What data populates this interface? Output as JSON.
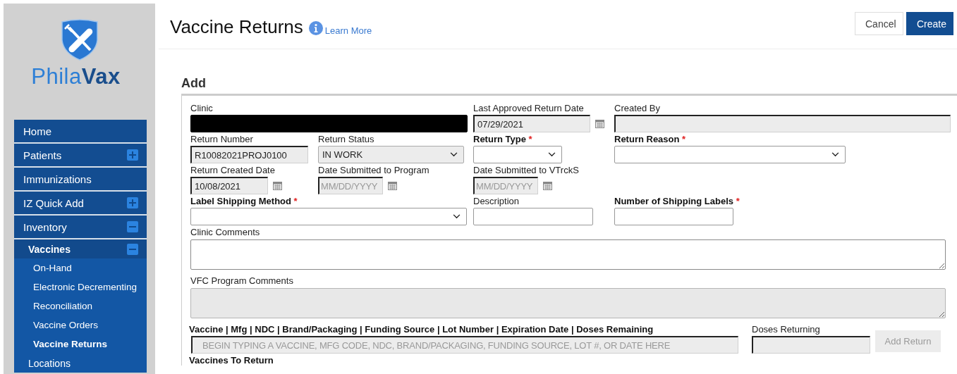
{
  "sidebar": {
    "logo": "Phila**Vax**",
    "nav": [
      {
        "label": "Home"
      },
      {
        "label": "Patients",
        "expanded": false
      },
      {
        "label": "Immunizations"
      },
      {
        "label": "IZ Quick Add",
        "expanded": false
      },
      {
        "label": "Inventory",
        "expanded": true,
        "children": [
          {
            "label": "Vaccines",
            "expanded": true,
            "children": [
              {
                "label": "On-Hand",
                "selected": false
              },
              {
                "label": "Electronic Decrementing",
                "selected": false
              },
              {
                "label": "Reconciliation",
                "selected": false
              },
              {
                "label": "Vaccine Orders",
                "selected": false
              },
              {
                "label": "Vaccine Returns",
                "selected": true
              }
            ]
          },
          {
            "label": "Locations"
          }
        ]
      }
    ]
  },
  "header": {
    "title": "Vaccine Returns",
    "link": "Learn More",
    "buttons": [
      {
        "label": "Cancel",
        "kind": "secondary"
      },
      {
        "label": "Create",
        "kind": "primary"
      }
    ]
  },
  "form": {
    "heading": "Add",
    "fields": [
      {
        "kind": "text",
        "label": "Clinic",
        "redacted": true,
        "disabled": false
      },
      {
        "kind": "date",
        "label": "Last Approved Return Date",
        "value": "07/29/2021",
        "disabled": true
      },
      {
        "kind": "text",
        "label": "Created By",
        "disabled": true
      },
      {
        "kind": "text",
        "label": "Return Number",
        "value": "R10082021PROJ0100",
        "disabled": true
      },
      {
        "kind": "select",
        "label": "Return Status",
        "value": "IN WORK",
        "disabled": true
      },
      {
        "kind": "select",
        "label": "Return Type",
        "required_mark": "*",
        "disabled": false
      },
      {
        "kind": "select",
        "label": "Return Reason",
        "required_mark": "*",
        "disabled": false
      },
      {
        "kind": "date",
        "label": "Return Created Date",
        "value": "10/08/2021",
        "disabled": true
      },
      {
        "kind": "date",
        "label": "Date Submitted to Program",
        "placeholder": "MM/DD/YYYY",
        "disabled": true
      },
      {
        "kind": "date",
        "label": "Date Submitted to VTrckS",
        "placeholder": "MM/DD/YYYY",
        "disabled": true
      },
      {
        "kind": "select",
        "label": "Label Shipping Method",
        "required_mark": "*",
        "disabled": false
      },
      {
        "kind": "text",
        "label": "Description",
        "disabled": false
      },
      {
        "kind": "text",
        "label": "Number of Shipping Labels",
        "required_mark": "*",
        "disabled": false
      },
      {
        "kind": "textarea",
        "label": "Clinic Comments",
        "disabled": false
      },
      {
        "kind": "textarea",
        "label": "VFC Program Comments",
        "disabled": true
      }
    ],
    "vaccine_search": {
      "label": "Vaccine | Mfg | NDC | Brand/Packaging | Funding Source | Lot Number | Expiration Date | Doses Remaining",
      "placeholder": "BEGIN TYPING A VACCINE, MFG CODE, NDC, BRAND/PACKAGING, FUNDING SOURCE, LOT #, OR DATE HERE",
      "disabled": true
    },
    "doses_returning": {
      "label": "Doses Returning",
      "disabled": true
    },
    "add_button": {
      "label": "Add Return",
      "disabled": true
    },
    "list_heading": "Vaccines To Return"
  }
}
